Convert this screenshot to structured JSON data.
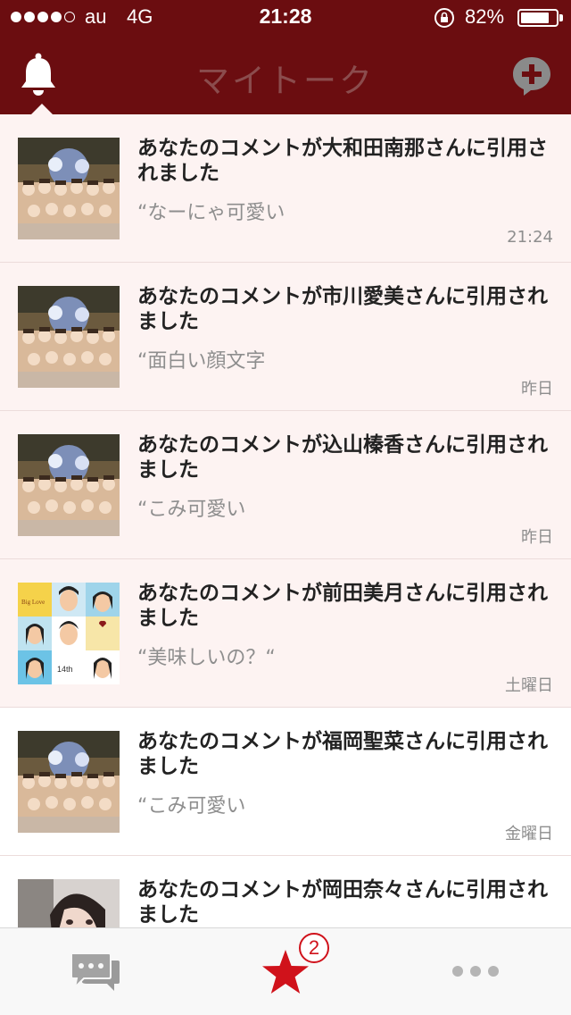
{
  "status_bar": {
    "carrier": "au",
    "network": "4G",
    "time": "21:28",
    "battery_percent_label": "82%",
    "battery_level": 0.82,
    "signal_bars_filled": 4,
    "signal_bars_total": 5
  },
  "header": {
    "title": "マイトーク",
    "left_icon": "bell-icon",
    "right_icon": "add-comment-icon"
  },
  "notifications": [
    {
      "title": "あなたのコメントが大和田南那さんに引用されました",
      "quote": "“なーにゃ可愛い",
      "time": "21:24",
      "unread": true
    },
    {
      "title": "あなたのコメントが市川愛美さんに引用されました",
      "quote": "“面白い顔文字",
      "time": "昨日",
      "unread": true
    },
    {
      "title": "あなたのコメントが込山榛香さんに引用されました",
      "quote": "“こみ可愛い",
      "time": "昨日",
      "unread": true
    },
    {
      "title": "あなたのコメントが前田美月さんに引用されました",
      "quote": "“美味しいの？“",
      "time": "土曜日",
      "unread": true
    },
    {
      "title": "あなたのコメントが福岡聖菜さんに引用されました",
      "quote": "“こみ可愛い",
      "time": "金曜日",
      "unread": false
    },
    {
      "title": "あなたのコメントが岡田奈々さんに引用されました",
      "quote": "",
      "time": "",
      "unread": false
    }
  ],
  "tabbar": {
    "chat_icon": "chat-bubbles-icon",
    "star_icon": "star-icon",
    "more_icon": "more-dots-icon",
    "star_badge": "2"
  },
  "colors": {
    "header_bg": "#6b0d10",
    "title": "#8b4c4d",
    "unread_bg": "#fdf3f2",
    "accent_red": "#d0121b"
  }
}
